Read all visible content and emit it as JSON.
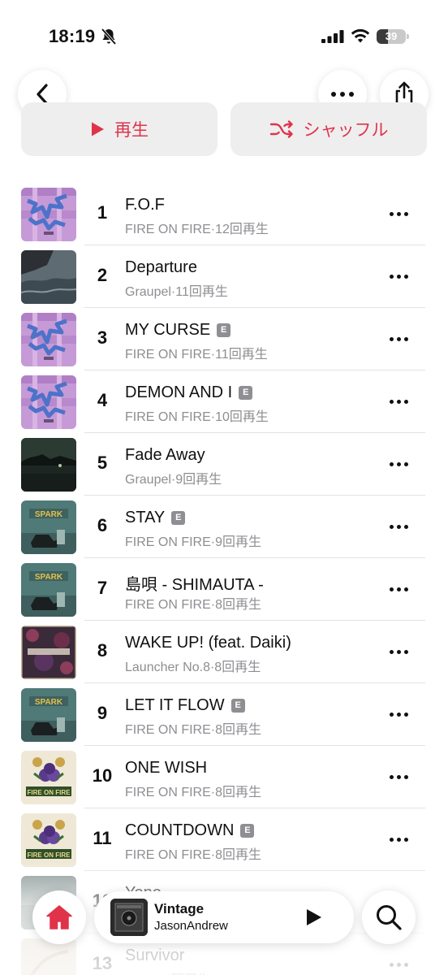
{
  "status_bar": {
    "time": "18:19",
    "battery_level": "39",
    "battery_fraction": 0.39
  },
  "header": {
    "back_icon": "chevron-left-icon",
    "more_icon": "ellipsis-icon",
    "share_icon": "share-icon"
  },
  "actions": {
    "play_label": "再生",
    "shuffle_label": "シャッフル",
    "accent_color": "#e0334a"
  },
  "tracks": [
    {
      "number": "1",
      "title": "F.O.F",
      "explicit": false,
      "artist": "FIRE ON FIRE",
      "plays": "12回再生",
      "art": "purple"
    },
    {
      "number": "2",
      "title": "Departure",
      "explicit": false,
      "artist": "Graupel",
      "plays": "11回再生",
      "art": "sea"
    },
    {
      "number": "3",
      "title": "MY CURSE",
      "explicit": true,
      "artist": "FIRE ON FIRE",
      "plays": "11回再生",
      "art": "purple"
    },
    {
      "number": "4",
      "title": "DEMON AND I",
      "explicit": true,
      "artist": "FIRE ON FIRE",
      "plays": "10回再生",
      "art": "purple"
    },
    {
      "number": "5",
      "title": "Fade Away",
      "explicit": false,
      "artist": "Graupel",
      "plays": "9回再生",
      "art": "night"
    },
    {
      "number": "6",
      "title": "STAY",
      "explicit": true,
      "artist": "FIRE ON FIRE",
      "plays": "9回再生",
      "art": "spark"
    },
    {
      "number": "7",
      "title": "島唄 - SHIMAUTA -",
      "explicit": false,
      "artist": "FIRE ON FIRE",
      "plays": "8回再生",
      "art": "spark"
    },
    {
      "number": "8",
      "title": "WAKE UP! (feat. Daiki)",
      "explicit": false,
      "artist": "Launcher No.8",
      "plays": "8回再生",
      "art": "floral"
    },
    {
      "number": "9",
      "title": "LET IT FLOW",
      "explicit": true,
      "artist": "FIRE ON FIRE",
      "plays": "8回再生",
      "art": "spark"
    },
    {
      "number": "10",
      "title": "ONE WISH",
      "explicit": false,
      "artist": "FIRE ON FIRE",
      "plays": "8回再生",
      "art": "fof"
    },
    {
      "number": "11",
      "title": "COUNTDOWN",
      "explicit": true,
      "artist": "FIRE ON FIRE",
      "plays": "8回再生",
      "art": "fof"
    },
    {
      "number": "12",
      "title": "Yono",
      "explicit": false,
      "artist": "",
      "plays": "",
      "art": "dim"
    },
    {
      "number": "13",
      "title": "Survivor",
      "explicit": false,
      "artist": "Quubi",
      "plays": "7回再生",
      "art": "dim2"
    }
  ],
  "explicit_label": "E",
  "now_playing": {
    "title": "Vintage",
    "artist": "JasonAndrew",
    "play_icon": "play-icon"
  },
  "nav": {
    "home_icon": "home-icon",
    "search_icon": "search-icon",
    "home_color": "#e0334a"
  }
}
